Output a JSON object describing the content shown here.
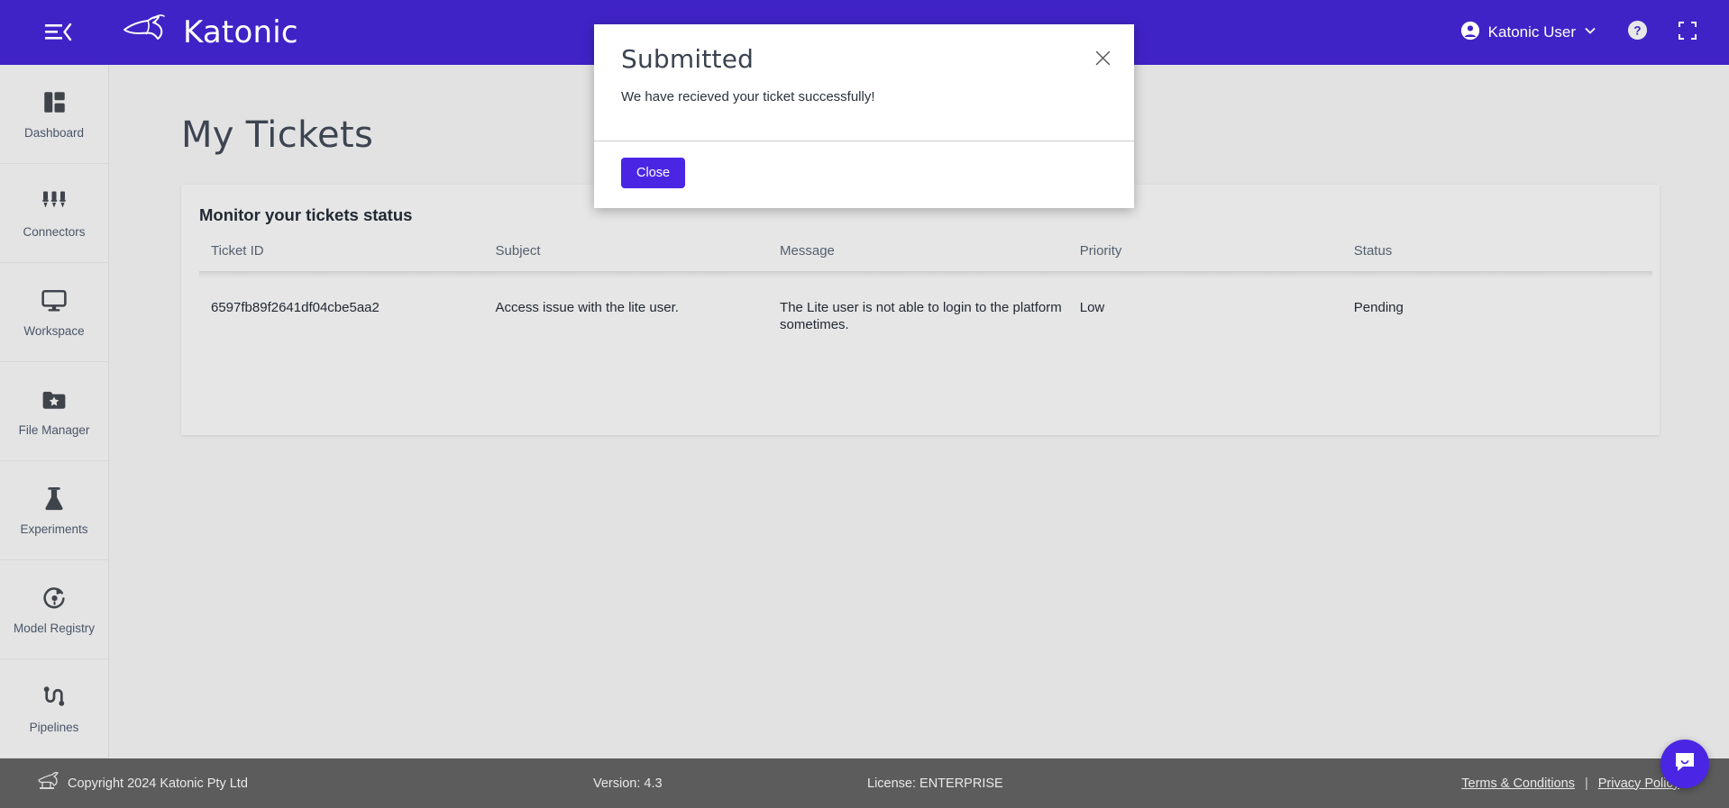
{
  "header": {
    "menu_icon": "hamburger-collapse-icon",
    "brand_name": "Katonic",
    "brand_logo_icon": "kangaroo-logo-icon",
    "user_name": "Katonic User",
    "user_icon": "account-circle-icon",
    "chevron_icon": "chevron-down-icon",
    "help_icon": "help-circle-icon",
    "fullscreen_icon": "fullscreen-icon",
    "accent_color": "#4023c6"
  },
  "sidebar": {
    "items": [
      {
        "label": "Dashboard",
        "icon": "dashboard-grid-icon"
      },
      {
        "label": "Connectors",
        "icon": "connectors-plugs-icon"
      },
      {
        "label": "Workspace",
        "icon": "monitor-icon"
      },
      {
        "label": "File Manager",
        "icon": "folder-star-icon"
      },
      {
        "label": "Experiments",
        "icon": "flask-icon"
      },
      {
        "label": "Model Registry",
        "icon": "model-refresh-icon"
      },
      {
        "label": "Pipelines",
        "icon": "pipeline-nodes-icon"
      }
    ]
  },
  "main": {
    "page_title": "My Tickets",
    "card_title": "Monitor your tickets status",
    "table": {
      "columns": [
        "Ticket ID",
        "Subject",
        "Message",
        "Priority",
        "Status"
      ],
      "rows": [
        {
          "ticket_id": "6597fb89f2641df04cbe5aa2",
          "subject": "Access issue with the lite user.",
          "message": "The Lite user is not able to login to the platform sometimes.",
          "priority": "Low",
          "status": "Pending"
        }
      ]
    }
  },
  "modal": {
    "title": "Submitted",
    "body": "We have recieved your ticket successfully!",
    "close_button_label": "Close",
    "close_icon": "close-x-icon",
    "button_color": "#4a26e4"
  },
  "footer": {
    "logo_icon": "kangaroo-logo-icon",
    "copyright": "Copyright 2024 Katonic Pty Ltd",
    "version": "Version: 4.3",
    "license": "License: ENTERPRISE",
    "terms_link": "Terms & Conditions",
    "separator": "|",
    "privacy_link": "Privacy Policy"
  },
  "chat": {
    "icon": "chat-bubble-smile-icon"
  }
}
